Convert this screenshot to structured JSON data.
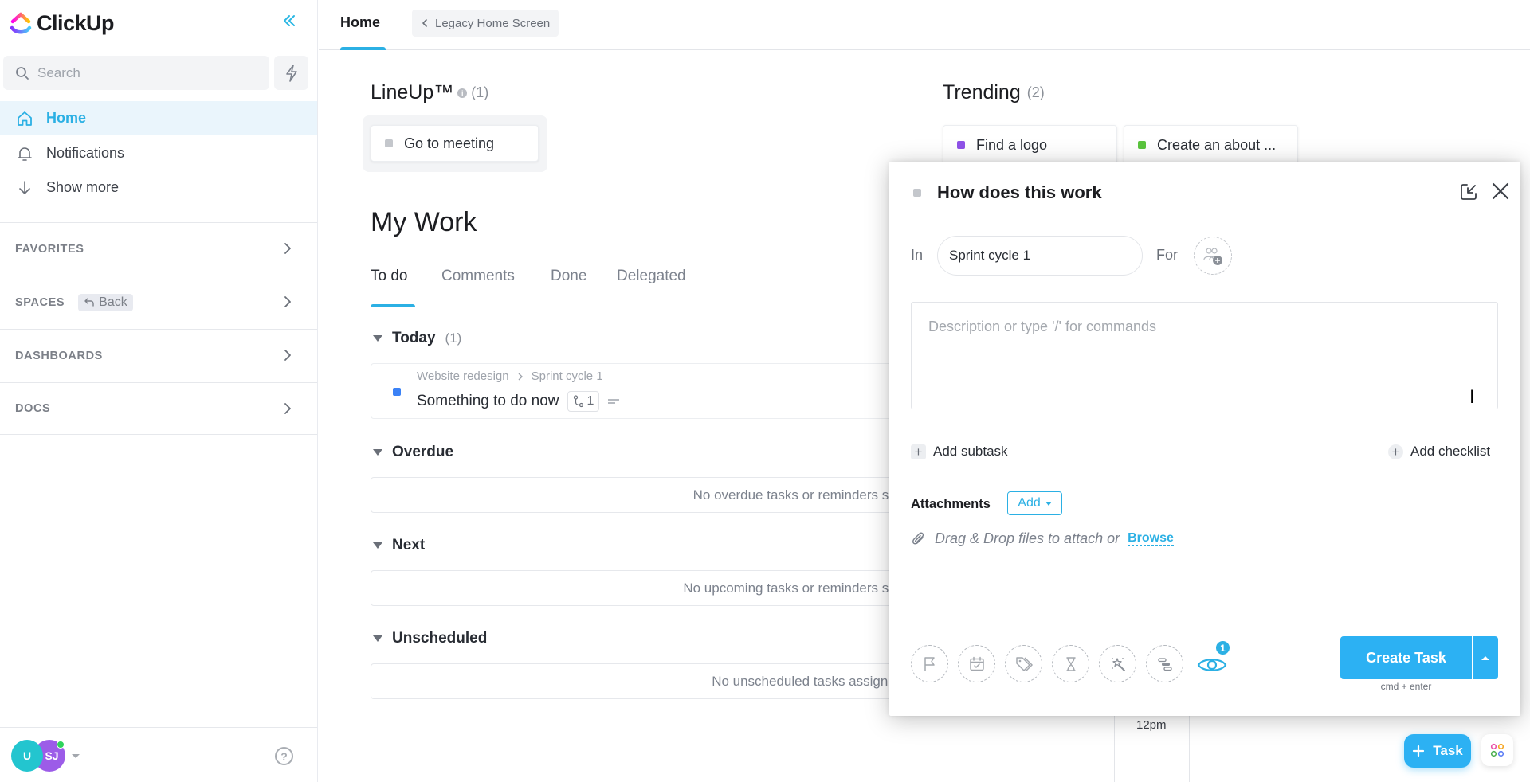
{
  "app": {
    "brand": "ClickUp",
    "colors": {
      "accent": "#2bb0e4",
      "primary_button": "#2cb1f3",
      "active_bg": "#eaf5fc"
    }
  },
  "sidebar": {
    "search_placeholder": "Search",
    "nav": [
      {
        "label": "Home",
        "icon": "home-icon",
        "active": true
      },
      {
        "label": "Notifications",
        "icon": "bell-icon",
        "active": false
      },
      {
        "label": "Show more",
        "icon": "arrow-down-icon",
        "active": false
      }
    ],
    "sections": [
      {
        "label": "FAVORITES"
      },
      {
        "label": "SPACES",
        "back_label": "Back"
      },
      {
        "label": "DASHBOARDS"
      },
      {
        "label": "DOCS"
      }
    ],
    "footer": {
      "avatars": [
        {
          "initials": "U",
          "color": "#23c5cf"
        },
        {
          "initials": "SJ",
          "color": "#9c5ce8",
          "online": true
        }
      ],
      "help": "?"
    }
  },
  "header": {
    "tab": "Home",
    "legacy_button": "Legacy Home Screen"
  },
  "lineup": {
    "title": "LineUp™",
    "count": "(1)",
    "items": [
      {
        "label": "Go to meeting",
        "color": "#c4c7cc"
      }
    ]
  },
  "trending": {
    "title": "Trending",
    "count": "(2)",
    "items": [
      {
        "label": "Find a logo",
        "color": "#8f52e8"
      },
      {
        "label": "Create an about ...",
        "color": "#5ac43d"
      }
    ]
  },
  "my_work": {
    "title": "My Work",
    "tabs": [
      {
        "label": "To do",
        "active": true
      },
      {
        "label": "Comments",
        "active": false
      },
      {
        "label": "Done",
        "active": false
      },
      {
        "label": "Delegated",
        "active": false
      }
    ],
    "groups": [
      {
        "label": "Today",
        "count": "(1)",
        "tasks": [
          {
            "breadcrumb": [
              "Website redesign",
              "Sprint cycle 1"
            ],
            "name": "Something to do now",
            "subtasks": "1",
            "status_color": "#3b82f6"
          }
        ]
      },
      {
        "label": "Overdue",
        "empty": "No overdue tasks or reminders scheduled."
      },
      {
        "label": "Next",
        "empty": "No upcoming tasks or reminders scheduled."
      },
      {
        "label": "Unscheduled",
        "empty": "No unscheduled tasks assigned to you."
      }
    ]
  },
  "calendar": {
    "time_label": "12pm"
  },
  "modal": {
    "title": "How does this work",
    "in_label": "In",
    "list_value": "Sprint cycle 1",
    "for_label": "For",
    "description_placeholder": "Description or type '/' for commands",
    "add_subtask": "Add subtask",
    "add_checklist": "Add checklist",
    "attachments_label": "Attachments",
    "attachments_add": "Add",
    "drop_text": "Drag & Drop files to attach or",
    "browse": "Browse",
    "action_icons": [
      "flag-icon",
      "calendar-icon",
      "tag-icon",
      "hourglass-icon",
      "magic-wand-icon",
      "gantt-icon"
    ],
    "watchers_count": "1",
    "create_button": "Create Task",
    "create_hint": "cmd + enter"
  },
  "fab": {
    "task_label": "Task"
  }
}
